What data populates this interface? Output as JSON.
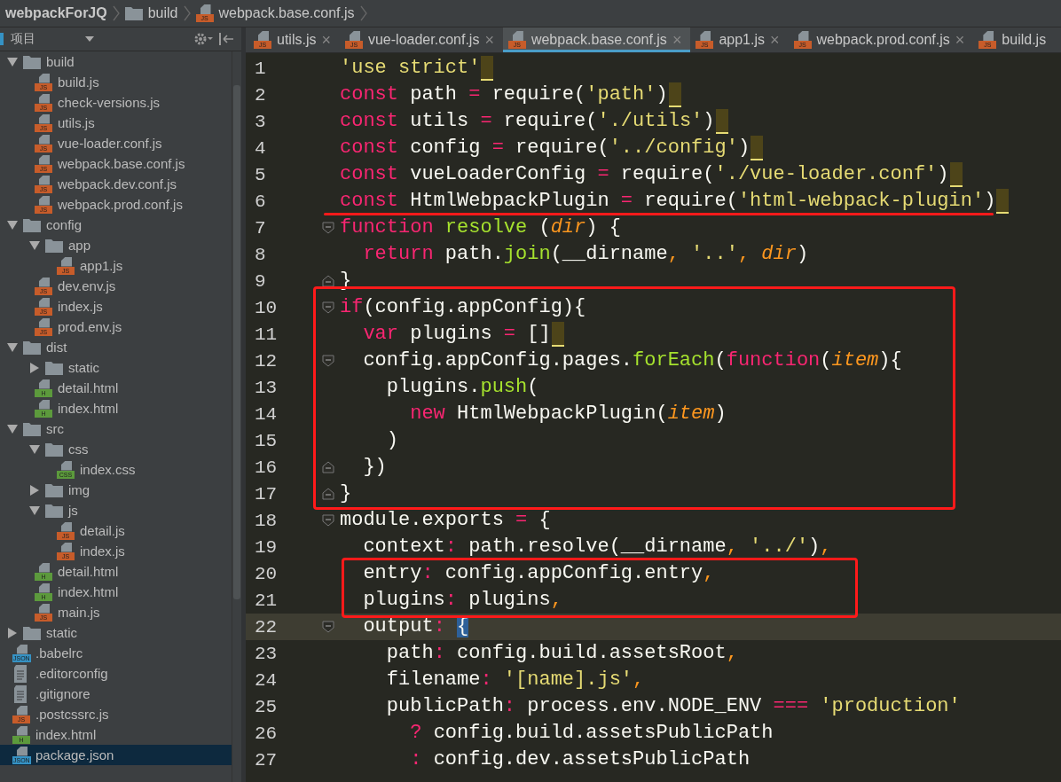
{
  "breadcrumb": [
    {
      "kind": "project",
      "label": "webpackForJQ"
    },
    {
      "kind": "folder",
      "label": "build"
    },
    {
      "kind": "file",
      "label": "webpack.base.conf.js",
      "badge": "JS",
      "color": "#c75c2a"
    }
  ],
  "sidebar": {
    "title": "项目",
    "tree": [
      {
        "kind": "folder",
        "name": "build",
        "expanded": true,
        "selected": false,
        "children": [
          {
            "kind": "file",
            "name": "build.js",
            "badge": "JS",
            "color": "#c75c2a",
            "selected": false
          },
          {
            "kind": "file",
            "name": "check-versions.js",
            "badge": "JS",
            "color": "#c75c2a",
            "selected": false
          },
          {
            "kind": "file",
            "name": "utils.js",
            "badge": "JS",
            "color": "#c75c2a",
            "selected": false
          },
          {
            "kind": "file",
            "name": "vue-loader.conf.js",
            "badge": "JS",
            "color": "#c75c2a",
            "selected": false
          },
          {
            "kind": "file",
            "name": "webpack.base.conf.js",
            "badge": "JS",
            "color": "#c75c2a",
            "selected": false
          },
          {
            "kind": "file",
            "name": "webpack.dev.conf.js",
            "badge": "JS",
            "color": "#c75c2a",
            "selected": false
          },
          {
            "kind": "file",
            "name": "webpack.prod.conf.js",
            "badge": "JS",
            "color": "#c75c2a",
            "selected": false
          }
        ]
      },
      {
        "kind": "folder",
        "name": "config",
        "expanded": true,
        "selected": false,
        "children": [
          {
            "kind": "folder",
            "name": "app",
            "expanded": true,
            "selected": false,
            "children": [
              {
                "kind": "file",
                "name": "app1.js",
                "badge": "JS",
                "color": "#c75c2a",
                "selected": false
              }
            ]
          },
          {
            "kind": "file",
            "name": "dev.env.js",
            "badge": "JS",
            "color": "#c75c2a",
            "selected": false
          },
          {
            "kind": "file",
            "name": "index.js",
            "badge": "JS",
            "color": "#c75c2a",
            "selected": false
          },
          {
            "kind": "file",
            "name": "prod.env.js",
            "badge": "JS",
            "color": "#c75c2a",
            "selected": false
          }
        ]
      },
      {
        "kind": "folder",
        "name": "dist",
        "expanded": true,
        "selected": false,
        "children": [
          {
            "kind": "folder",
            "name": "static",
            "expanded": false,
            "selected": false
          },
          {
            "kind": "file",
            "name": "detail.html",
            "badge": "H",
            "color": "#5c9a3c",
            "selected": false
          },
          {
            "kind": "file",
            "name": "index.html",
            "badge": "H",
            "color": "#5c9a3c",
            "selected": false
          }
        ]
      },
      {
        "kind": "folder",
        "name": "src",
        "expanded": true,
        "selected": false,
        "children": [
          {
            "kind": "folder",
            "name": "css",
            "expanded": true,
            "selected": false,
            "children": [
              {
                "kind": "file",
                "name": "index.css",
                "badge": "CSS",
                "color": "#5c9a3c",
                "selected": false
              }
            ]
          },
          {
            "kind": "folder",
            "name": "img",
            "expanded": false,
            "selected": false
          },
          {
            "kind": "folder",
            "name": "js",
            "expanded": true,
            "selected": false,
            "children": [
              {
                "kind": "file",
                "name": "detail.js",
                "badge": "JS",
                "color": "#c75c2a",
                "selected": false
              },
              {
                "kind": "file",
                "name": "index.js",
                "badge": "JS",
                "color": "#c75c2a",
                "selected": false
              }
            ]
          },
          {
            "kind": "file",
            "name": "detail.html",
            "badge": "H",
            "color": "#5c9a3c",
            "selected": false
          },
          {
            "kind": "file",
            "name": "index.html",
            "badge": "H",
            "color": "#5c9a3c",
            "selected": false
          },
          {
            "kind": "file",
            "name": "main.js",
            "badge": "JS",
            "color": "#c75c2a",
            "selected": false
          }
        ]
      },
      {
        "kind": "folder",
        "name": "static",
        "expanded": false,
        "selected": false
      },
      {
        "kind": "file",
        "name": ".babelrc",
        "badge": "JSON",
        "color": "#3592c4",
        "selected": false
      },
      {
        "kind": "text-file",
        "name": ".editorconfig",
        "selected": false
      },
      {
        "kind": "text-file",
        "name": ".gitignore",
        "selected": false
      },
      {
        "kind": "file",
        "name": ".postcssrc.js",
        "badge": "JS",
        "color": "#c75c2a",
        "selected": false
      },
      {
        "kind": "file",
        "name": "index.html",
        "badge": "H",
        "color": "#5c9a3c",
        "selected": false
      },
      {
        "kind": "file",
        "name": "package.json",
        "badge": "JSON",
        "color": "#3592c4",
        "selected": true
      }
    ]
  },
  "tabs": [
    {
      "label": "utils.js",
      "badge": "JS",
      "selected": false,
      "close": "×"
    },
    {
      "label": "vue-loader.conf.js",
      "badge": "JS",
      "selected": false,
      "close": "×"
    },
    {
      "label": "webpack.base.conf.js",
      "badge": "JS",
      "selected": true,
      "close": "×"
    },
    {
      "label": "app1.js",
      "badge": "JS",
      "selected": false,
      "close": "×"
    },
    {
      "label": "webpack.prod.conf.js",
      "badge": "JS",
      "selected": false,
      "close": "×"
    },
    {
      "label": "build.js",
      "badge": "JS",
      "selected": false
    }
  ],
  "editor": {
    "lines": [
      {
        "number": "1",
        "warning": true,
        "tokens": [
          {
            "kind": "str",
            "text": "'use strict'"
          }
        ]
      },
      {
        "number": "2",
        "warning": true,
        "tokens": [
          {
            "kind": "kw",
            "text": "const"
          },
          {
            "kind": "plain",
            "text": " path "
          },
          {
            "kind": "op",
            "text": "="
          },
          {
            "kind": "plain",
            "text": " require("
          },
          {
            "kind": "str",
            "text": "'path'"
          },
          {
            "kind": "plain",
            "text": ")"
          }
        ]
      },
      {
        "number": "3",
        "warning": true,
        "tokens": [
          {
            "kind": "kw",
            "text": "const"
          },
          {
            "kind": "plain",
            "text": " utils "
          },
          {
            "kind": "op",
            "text": "="
          },
          {
            "kind": "plain",
            "text": " require("
          },
          {
            "kind": "str",
            "text": "'./utils'"
          },
          {
            "kind": "plain",
            "text": ")"
          }
        ]
      },
      {
        "number": "4",
        "warning": true,
        "tokens": [
          {
            "kind": "kw",
            "text": "const"
          },
          {
            "kind": "plain",
            "text": " config "
          },
          {
            "kind": "op",
            "text": "="
          },
          {
            "kind": "plain",
            "text": " require("
          },
          {
            "kind": "str",
            "text": "'../config'"
          },
          {
            "kind": "plain",
            "text": ")"
          }
        ]
      },
      {
        "number": "5",
        "warning": true,
        "tokens": [
          {
            "kind": "kw",
            "text": "const"
          },
          {
            "kind": "plain",
            "text": " vueLoaderConfig "
          },
          {
            "kind": "op",
            "text": "="
          },
          {
            "kind": "plain",
            "text": " require("
          },
          {
            "kind": "str",
            "text": "'./vue-loader.conf'"
          },
          {
            "kind": "plain",
            "text": ")"
          }
        ]
      },
      {
        "number": "6",
        "warning": true,
        "tokens": [
          {
            "kind": "kw",
            "text": "const"
          },
          {
            "kind": "plain",
            "text": " HtmlWebpackPlugin "
          },
          {
            "kind": "op",
            "text": "="
          },
          {
            "kind": "plain",
            "text": " require("
          },
          {
            "kind": "str",
            "text": "'html-webpack-plugin'"
          },
          {
            "kind": "plain",
            "text": ")"
          }
        ]
      },
      {
        "number": "7",
        "fold_start": true,
        "tokens": [
          {
            "kind": "kw",
            "text": "function"
          },
          {
            "kind": "fn",
            "text": " resolve"
          },
          {
            "kind": "plain",
            "text": " ("
          },
          {
            "kind": "param",
            "text": "dir"
          },
          {
            "kind": "plain",
            "text": ") {"
          }
        ]
      },
      {
        "number": "8",
        "tokens": [
          {
            "kind": "kw",
            "text": "  return"
          },
          {
            "kind": "plain",
            "text": " path."
          },
          {
            "kind": "fn",
            "text": "join"
          },
          {
            "kind": "plain",
            "text": "(__dirname"
          },
          {
            "kind": "comma",
            "text": ", "
          },
          {
            "kind": "str",
            "text": "'..'"
          },
          {
            "kind": "comma",
            "text": ", "
          },
          {
            "kind": "param",
            "text": "dir"
          },
          {
            "kind": "plain",
            "text": ")"
          }
        ]
      },
      {
        "number": "9",
        "fold_end": true,
        "tokens": [
          {
            "kind": "plain",
            "text": "}"
          }
        ]
      },
      {
        "number": "10",
        "fold_start": true,
        "tokens": [
          {
            "kind": "kw",
            "text": "if"
          },
          {
            "kind": "plain",
            "text": "(config.appConfig){"
          }
        ]
      },
      {
        "number": "11",
        "warning": true,
        "tokens": [
          {
            "kind": "kw",
            "text": "  var"
          },
          {
            "kind": "plain",
            "text": " plugins "
          },
          {
            "kind": "op",
            "text": "="
          },
          {
            "kind": "plain",
            "text": " []"
          }
        ]
      },
      {
        "number": "12",
        "fold_start": true,
        "tokens": [
          {
            "kind": "plain",
            "text": "  config.appConfig.pages."
          },
          {
            "kind": "fn",
            "text": "forEach"
          },
          {
            "kind": "plain",
            "text": "("
          },
          {
            "kind": "kw",
            "text": "function"
          },
          {
            "kind": "plain",
            "text": "("
          },
          {
            "kind": "param",
            "text": "item"
          },
          {
            "kind": "plain",
            "text": "){"
          }
        ]
      },
      {
        "number": "13",
        "tokens": [
          {
            "kind": "plain",
            "text": "    plugins."
          },
          {
            "kind": "fn",
            "text": "push"
          },
          {
            "kind": "plain",
            "text": "("
          }
        ]
      },
      {
        "number": "14",
        "tokens": [
          {
            "kind": "kw",
            "text": "      new"
          },
          {
            "kind": "plain",
            "text": " HtmlWebpackPlugin("
          },
          {
            "kind": "param",
            "text": "item"
          },
          {
            "kind": "plain",
            "text": ")"
          }
        ]
      },
      {
        "number": "15",
        "tokens": [
          {
            "kind": "plain",
            "text": "    )"
          }
        ]
      },
      {
        "number": "16",
        "fold_end": true,
        "tokens": [
          {
            "kind": "plain",
            "text": "  })"
          }
        ]
      },
      {
        "number": "17",
        "fold_end": true,
        "tokens": [
          {
            "kind": "plain",
            "text": "}"
          }
        ]
      },
      {
        "number": "18",
        "fold_start": true,
        "tokens": [
          {
            "kind": "plain",
            "text": "module.exports "
          },
          {
            "kind": "op",
            "text": "="
          },
          {
            "kind": "plain",
            "text": " {"
          }
        ]
      },
      {
        "number": "19",
        "tokens": [
          {
            "kind": "plain",
            "text": "  context"
          },
          {
            "kind": "op",
            "text": ":"
          },
          {
            "kind": "plain",
            "text": " path.resolve(__dirname"
          },
          {
            "kind": "comma",
            "text": ", "
          },
          {
            "kind": "str",
            "text": "'../'"
          },
          {
            "kind": "plain",
            "text": ")"
          },
          {
            "kind": "comma",
            "text": ","
          }
        ]
      },
      {
        "number": "20",
        "tokens": [
          {
            "kind": "plain",
            "text": "  entry"
          },
          {
            "kind": "op",
            "text": ":"
          },
          {
            "kind": "plain",
            "text": " config.appConfig.entry"
          },
          {
            "kind": "comma",
            "text": ","
          }
        ]
      },
      {
        "number": "21",
        "tokens": [
          {
            "kind": "plain",
            "text": "  plugins"
          },
          {
            "kind": "op",
            "text": ":"
          },
          {
            "kind": "plain",
            "text": " plugins"
          },
          {
            "kind": "comma",
            "text": ","
          }
        ]
      },
      {
        "number": "22",
        "fold_start": true,
        "current": true,
        "tokens": [
          {
            "kind": "plain",
            "text": "  output"
          },
          {
            "kind": "op",
            "text": ":"
          },
          {
            "kind": "match",
            "text": " {"
          }
        ]
      },
      {
        "number": "23",
        "tokens": [
          {
            "kind": "plain",
            "text": "    path"
          },
          {
            "kind": "op",
            "text": ":"
          },
          {
            "kind": "plain",
            "text": " config.build.assetsRoot"
          },
          {
            "kind": "comma",
            "text": ","
          }
        ]
      },
      {
        "number": "24",
        "tokens": [
          {
            "kind": "plain",
            "text": "    filename"
          },
          {
            "kind": "op",
            "text": ":"
          },
          {
            "kind": "str",
            "text": " '[name].js'"
          },
          {
            "kind": "comma",
            "text": ","
          }
        ]
      },
      {
        "number": "25",
        "tokens": [
          {
            "kind": "plain",
            "text": "    publicPath"
          },
          {
            "kind": "op",
            "text": ":"
          },
          {
            "kind": "plain",
            "text": " process.env.NODE_ENV "
          },
          {
            "kind": "op",
            "text": "==="
          },
          {
            "kind": "str",
            "text": " 'production'"
          }
        ]
      },
      {
        "number": "26",
        "tokens": [
          {
            "kind": "op",
            "text": "      ?"
          },
          {
            "kind": "plain",
            "text": " config.build.assetsPublicPath"
          }
        ]
      },
      {
        "number": "27",
        "tokens": [
          {
            "kind": "op",
            "text": "      :"
          },
          {
            "kind": "plain",
            "text": " config.dev.assetsPublicPath"
          }
        ]
      }
    ]
  }
}
